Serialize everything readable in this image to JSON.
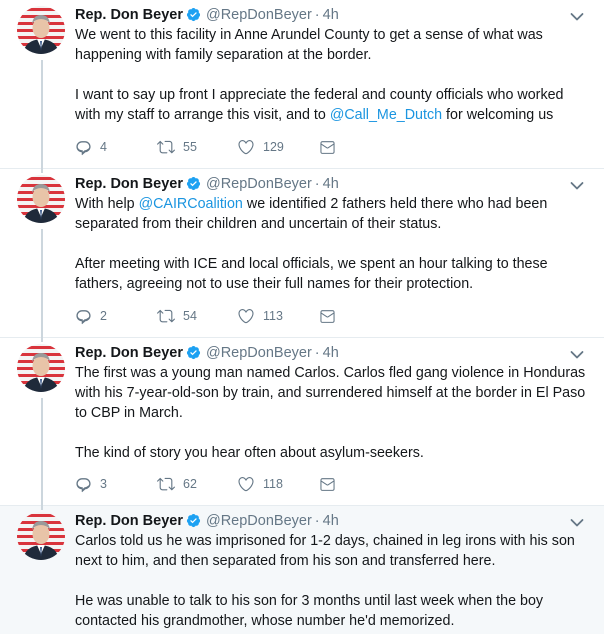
{
  "tweets": [
    {
      "name": "Rep. Don Beyer",
      "handle": "@RepDonBeyer",
      "dot": "·",
      "time": "4h",
      "lines": [
        "We went to this facility in Anne Arundel County to get a sense of what was",
        "happening with family separation at the border.",
        "",
        "I want to say up front I appreciate the federal and county officials who worked"
      ],
      "last_line_pre": "with my staff to arrange this visit, and to ",
      "last_line_mention": "@Call_Me_Dutch",
      "last_line_post": " for welcoming us",
      "replies": "4",
      "retweets": "55",
      "likes": "129"
    },
    {
      "name": "Rep. Don Beyer",
      "handle": "@RepDonBeyer",
      "dot": "·",
      "time": "4h",
      "first_line_pre": "With help ",
      "first_line_mention": "@CAIRCoalition",
      "first_line_post": " we identified 2 fathers held there who had been",
      "lines": [
        "separated from their children and uncertain of their status.",
        "",
        "After meeting with ICE and local officials, we spent an hour talking to these",
        "fathers, agreeing not to use their full names for their protection."
      ],
      "replies": "2",
      "retweets": "54",
      "likes": "113"
    },
    {
      "name": "Rep. Don Beyer",
      "handle": "@RepDonBeyer",
      "dot": "·",
      "time": "4h",
      "lines": [
        "The first was a young man named Carlos. Carlos fled gang violence in Honduras",
        "with his 7-year-old-son by train, and surrendered himself at the border in El Paso",
        "to CBP in March.",
        "",
        "The kind of story you hear often about asylum-seekers."
      ],
      "replies": "3",
      "retweets": "62",
      "likes": "118"
    },
    {
      "name": "Rep. Don Beyer",
      "handle": "@RepDonBeyer",
      "dot": "·",
      "time": "4h",
      "lines": [
        "Carlos told us he was imprisoned for 1-2 days, chained in leg irons with his son",
        "next to him, and then separated from his son and transferred here.",
        "",
        "He was unable to talk to his son for 3 months until last week when the boy",
        "contacted his grandmother, whose number he'd memorized."
      ]
    }
  ],
  "icons": {
    "verified": "verified-badge-icon",
    "reply": "reply-icon",
    "retweet": "retweet-icon",
    "like": "heart-icon",
    "message": "envelope-icon",
    "more": "chevron-down-icon"
  },
  "colors": {
    "text": "#14171a",
    "secondary": "#657786",
    "link": "#1b95e0",
    "verified": "#1da1f2",
    "highlight_bg": "#f5f8fa",
    "thread_line": "#ccd6dd"
  }
}
